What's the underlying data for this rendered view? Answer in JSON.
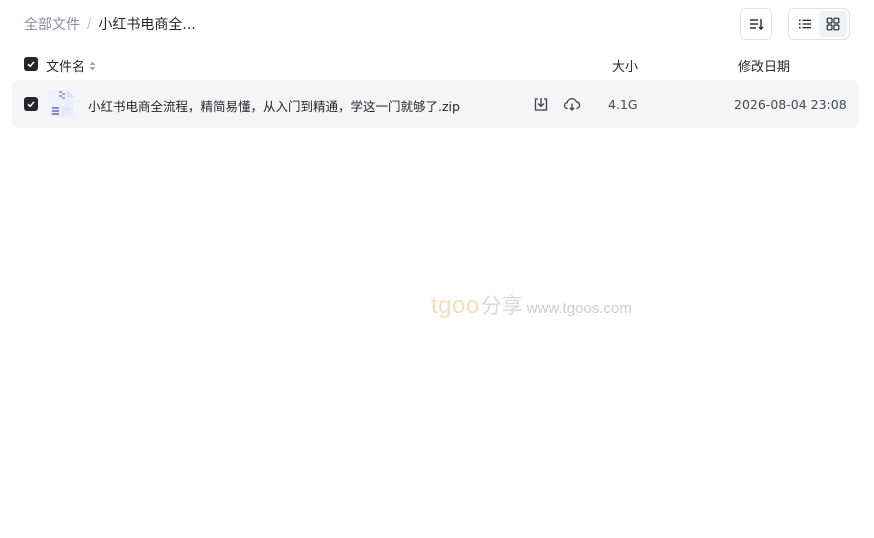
{
  "breadcrumb": {
    "root": "全部文件",
    "separator": "/",
    "current": "小红书电商全..."
  },
  "toolbar": {
    "sort_icon": "sort-lines-icon",
    "view_list_icon": "list-view-icon",
    "view_grid_icon": "grid-view-icon",
    "active_view": "list"
  },
  "table": {
    "columns": {
      "name": "文件名",
      "size": "大小",
      "date": "修改日期"
    },
    "rows": [
      {
        "name": "小红书电商全流程，精简易懂，从入门到精通，学这一门就够了.zip",
        "size": "4.1G",
        "date": "2026-08-04 23:08",
        "selected": true,
        "icon": "zip-file-icon"
      }
    ]
  },
  "watermark": {
    "brand": "tgoo",
    "cn": "分享",
    "url": "www.tgoos.com"
  },
  "colors": {
    "accent": "#25262b",
    "row_bg": "#f5f5f6",
    "watermark_brand": "#f4dfb9"
  }
}
